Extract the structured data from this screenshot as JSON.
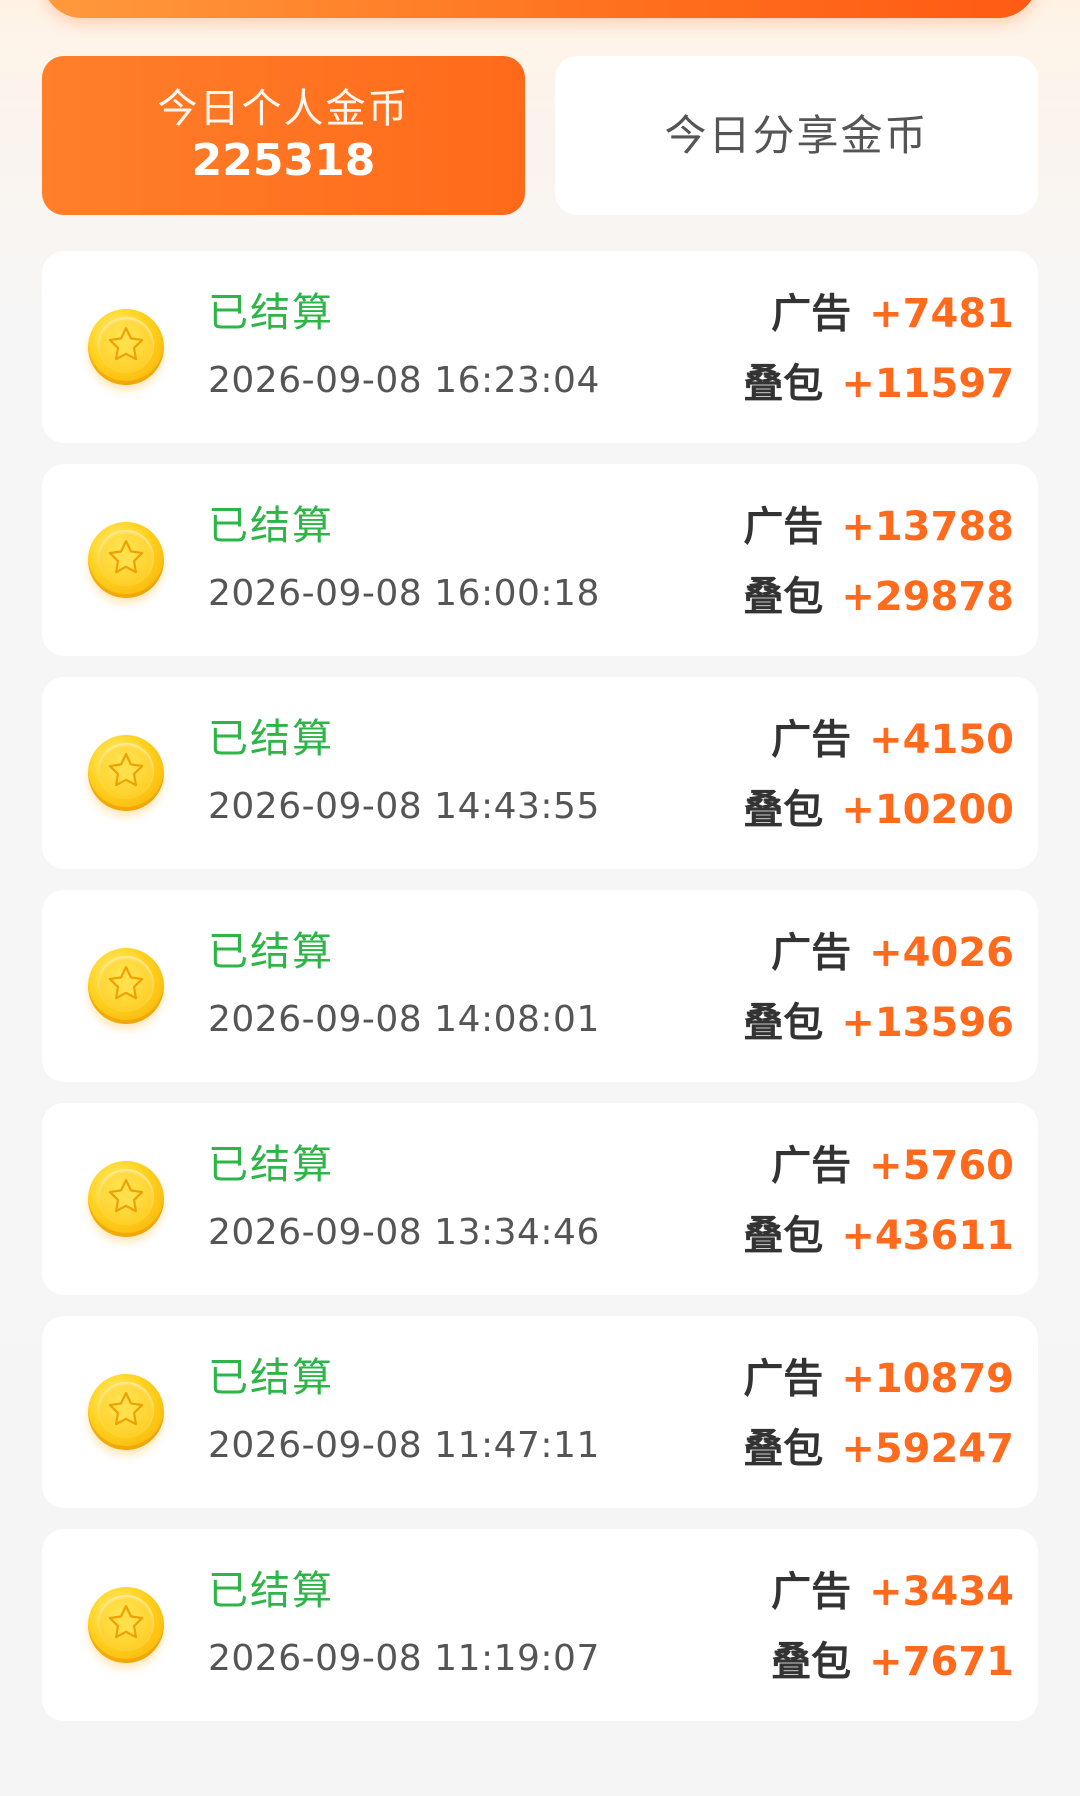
{
  "header": {
    "tabs": [
      {
        "label": "今日个人金币",
        "value": "225318",
        "active": true
      },
      {
        "label": "今日分享金币",
        "active": false
      }
    ]
  },
  "records": [
    {
      "status": "已结算",
      "time": "2026-09-08 16:23:04",
      "ad_label": "广告",
      "ad_amount": "+7481",
      "pack_label": "叠包",
      "pack_amount": "+11597"
    },
    {
      "status": "已结算",
      "time": "2026-09-08 16:00:18",
      "ad_label": "广告",
      "ad_amount": "+13788",
      "pack_label": "叠包",
      "pack_amount": "+29878"
    },
    {
      "status": "已结算",
      "time": "2026-09-08 14:43:55",
      "ad_label": "广告",
      "ad_amount": "+4150",
      "pack_label": "叠包",
      "pack_amount": "+10200"
    },
    {
      "status": "已结算",
      "time": "2026-09-08 14:08:01",
      "ad_label": "广告",
      "ad_amount": "+4026",
      "pack_label": "叠包",
      "pack_amount": "+13596"
    },
    {
      "status": "已结算",
      "time": "2026-09-08 13:34:46",
      "ad_label": "广告",
      "ad_amount": "+5760",
      "pack_label": "叠包",
      "pack_amount": "+43611"
    },
    {
      "status": "已结算",
      "time": "2026-09-08 11:47:11",
      "ad_label": "广告",
      "ad_amount": "+10879",
      "pack_label": "叠包",
      "pack_amount": "+59247"
    },
    {
      "status": "已结算",
      "time": "2026-09-08 11:19:07",
      "ad_label": "广告",
      "ad_amount": "+3434",
      "pack_label": "叠包",
      "pack_amount": "+7671"
    }
  ],
  "colors": {
    "accent": "#ff6a1d",
    "status_green": "#2db548",
    "coin_gold": "#ffc514"
  },
  "icons": {
    "coin": "star-coin-icon"
  }
}
